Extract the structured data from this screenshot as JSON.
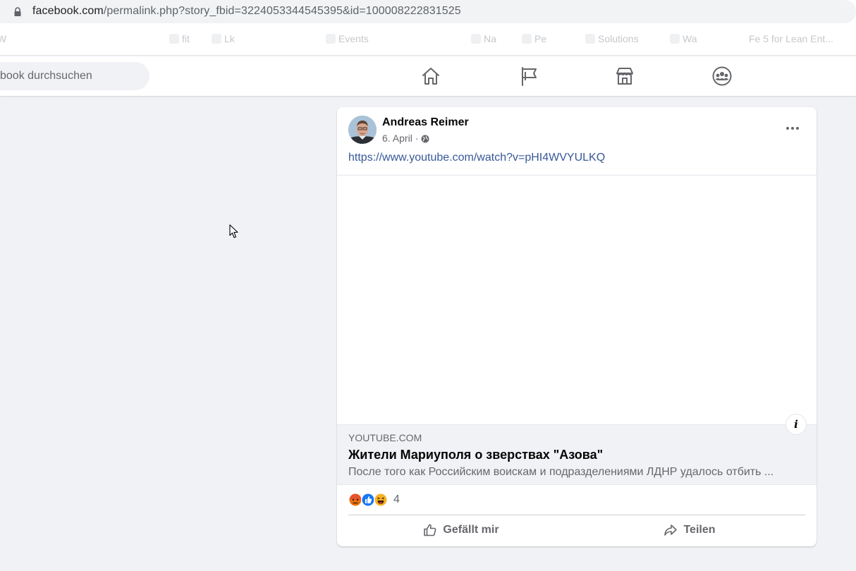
{
  "browser": {
    "url_domain": "facebook.com",
    "url_rest": "/permalink.php?story_fbid=3224053344545395&id=100008222831525",
    "bookmarks": [
      "W",
      "fit",
      "Lk",
      "Events",
      "Na",
      "Pe",
      "Solutions",
      "Wa",
      "Fe 5 for Lean Ent..."
    ]
  },
  "fb_header": {
    "search_placeholder": "book durchsuchen",
    "nav": [
      "home-icon",
      "pages-flag-icon",
      "marketplace-icon",
      "groups-icon"
    ]
  },
  "post": {
    "author": "Andreas Reimer",
    "date": "6. April ·",
    "audience_icon": "globe-icon",
    "link": "https://www.youtube.com/watch?v=pHI4WVYULKQ",
    "preview": {
      "domain": "YOUTUBE.COM",
      "title": "Жители Мариуполя о зверствах \"Азова\"",
      "description": "После того как Российским воискам и подразделениями ЛДНР удалось отбить ..."
    },
    "reaction_icons": [
      "angry-icon",
      "like-icon",
      "haha-icon"
    ],
    "reaction_count": "4",
    "actions": {
      "like": "Gefällt mir",
      "share": "Teilen"
    }
  },
  "colors": {
    "link": "#385898",
    "background": "#f0f2f5",
    "like_blue": "#1877f2"
  }
}
